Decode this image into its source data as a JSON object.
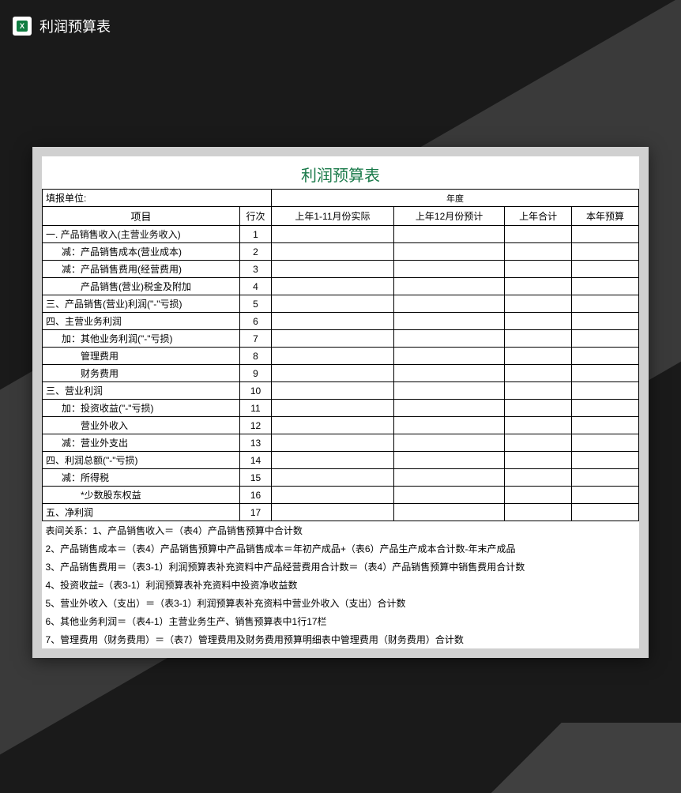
{
  "header": {
    "title": "利润预算表"
  },
  "sheet": {
    "title": "利润预算表",
    "unit_label": "填报单位:",
    "year_label": "年度",
    "columns": {
      "project": "项目",
      "row_num": "行次",
      "col1": "上年1-11月份实际",
      "col2": "上年12月份预计",
      "col3": "上年合计",
      "col4": "本年预算"
    },
    "rows": [
      {
        "n": "1",
        "label": "一. 产品销售收入(主营业务收入)",
        "indent": 0
      },
      {
        "n": "2",
        "label": "减：产品销售成本(营业成本)",
        "indent": 1
      },
      {
        "n": "3",
        "label": "减：产品销售费用(经营费用)",
        "indent": 1
      },
      {
        "n": "4",
        "label": "产品销售(营业)税金及附加",
        "indent": 2
      },
      {
        "n": "5",
        "label": "三、产品销售(营业)利润(\"-\"亏损)",
        "indent": 0
      },
      {
        "n": "6",
        "label": "四、主营业务利润",
        "indent": 0
      },
      {
        "n": "7",
        "label": "加：其他业务利润(\"-\"亏损)",
        "indent": 1
      },
      {
        "n": "8",
        "label": "管理费用",
        "indent": 2
      },
      {
        "n": "9",
        "label": "财务费用",
        "indent": 2
      },
      {
        "n": "10",
        "label": "三、营业利润",
        "indent": 0
      },
      {
        "n": "11",
        "label": "加：投资收益(\"-\"亏损)",
        "indent": 1
      },
      {
        "n": "12",
        "label": "营业外收入",
        "indent": 2
      },
      {
        "n": "13",
        "label": "减：营业外支出",
        "indent": 1
      },
      {
        "n": "14",
        "label": "四、利润总额(\"-\"亏损)",
        "indent": 0
      },
      {
        "n": "15",
        "label": "减：所得税",
        "indent": 1
      },
      {
        "n": "16",
        "label": "*少数股东权益",
        "indent": 2
      },
      {
        "n": "17",
        "label": "五、净利润",
        "indent": 0
      }
    ],
    "notes": [
      "表间关系：1、产品销售收入＝（表4）产品销售预算中合计数",
      "2、产品销售成本＝（表4）产品销售预算中产品销售成本＝年初产成品+（表6）产品生产成本合计数-年末产成品",
      "3、产品销售费用＝（表3-1）利润预算表补充资料中产品经营费用合计数＝（表4）产品销售预算中销售费用合计数",
      "4、投资收益=（表3-1）利润预算表补充资料中投资净收益数",
      "5、营业外收入（支出）＝（表3-1）利润预算表补充资料中营业外收入（支出）合计数",
      "6、其他业务利润＝（表4-1）主营业务生产、销售预算表中1行17栏",
      "7、管理费用（财务费用）＝（表7）管理费用及财务费用预算明细表中管理费用（财务费用）合计数"
    ]
  }
}
